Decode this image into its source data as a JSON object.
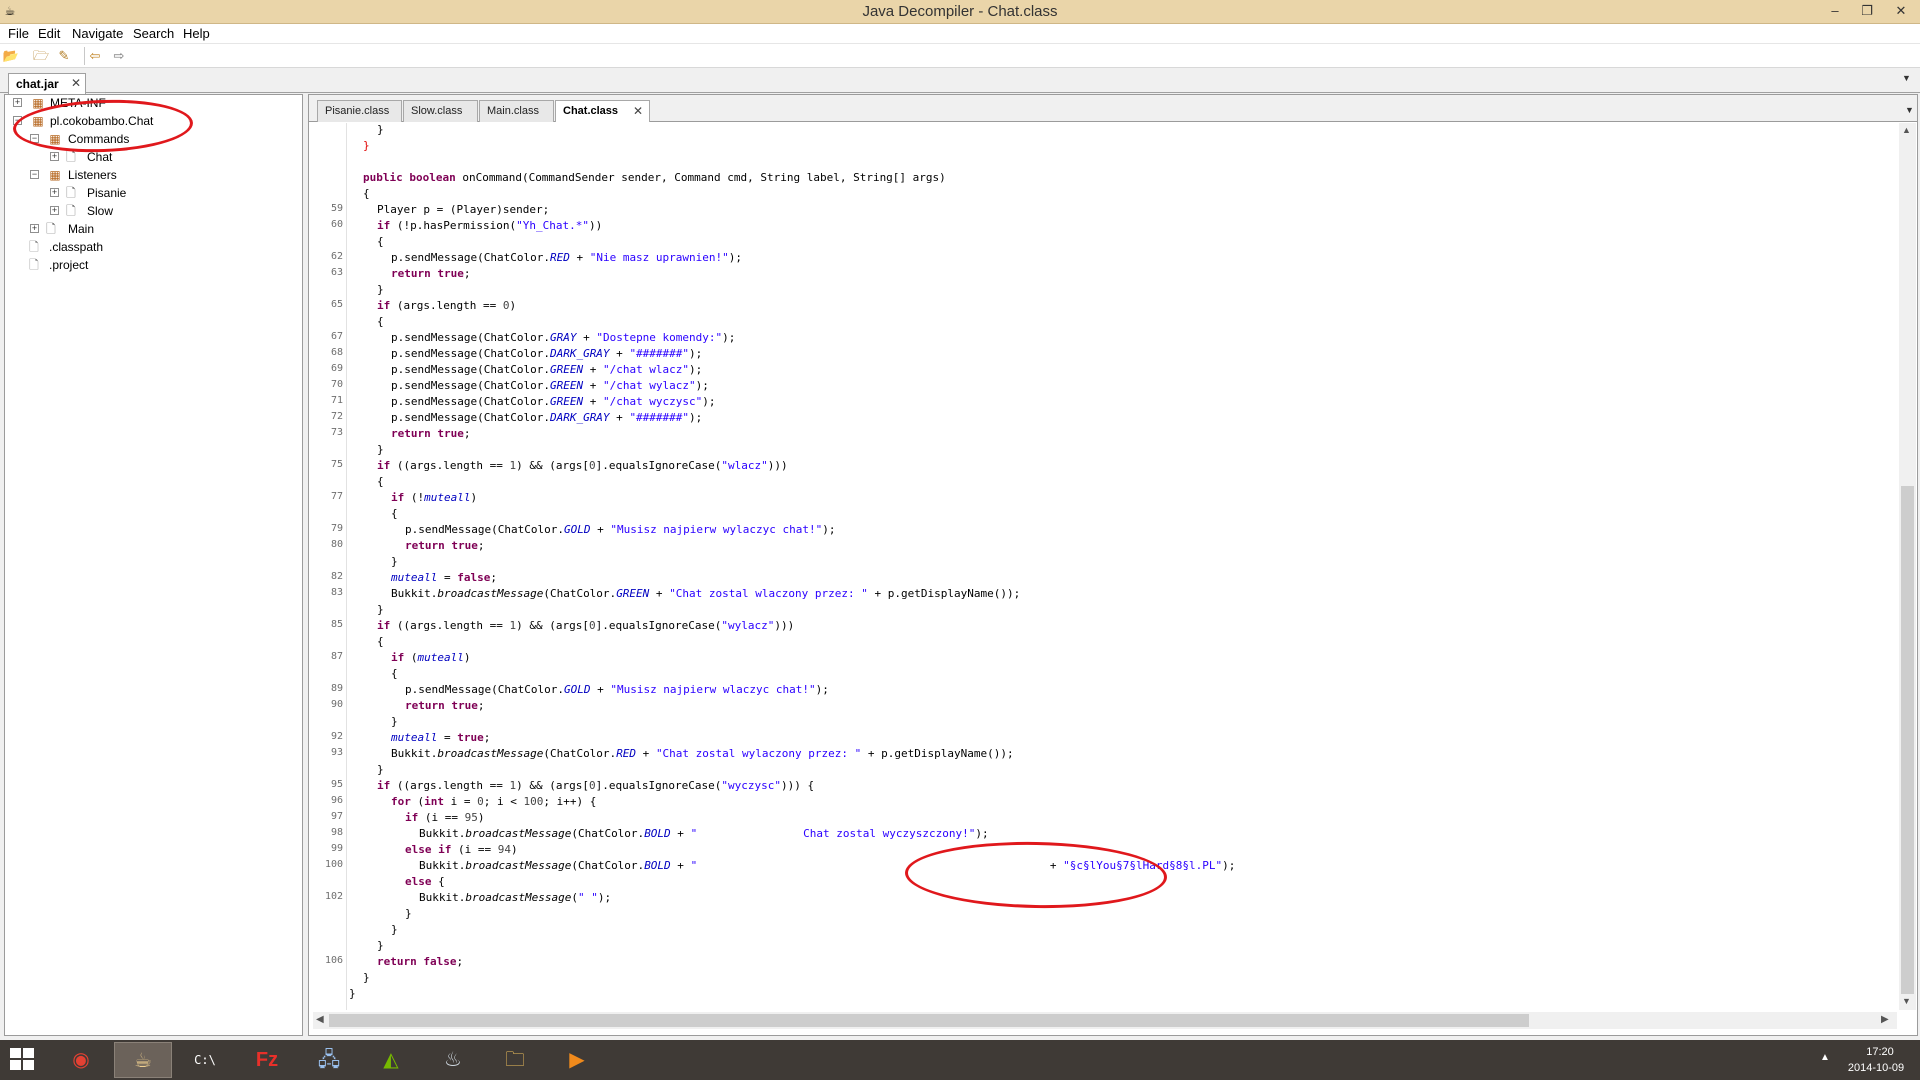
{
  "window": {
    "title": "Java Decompiler - Chat.class",
    "minimize_glyph": "–",
    "maximize_glyph": "❐",
    "close_glyph": "✕"
  },
  "menu": [
    "File",
    "Edit",
    "Navigate",
    "Search",
    "Help"
  ],
  "toolbar": {
    "icons": [
      "open-file-icon",
      "open-type-icon",
      "find-icon",
      "back-icon",
      "forward-icon"
    ],
    "glyphs": [
      "📂",
      "🗁",
      "✎",
      "⇦",
      "⇨"
    ]
  },
  "jar_tab": {
    "label": "chat.jar",
    "close": "✕",
    "dropdown": "▼"
  },
  "tree": {
    "meta_inf": "META-INF",
    "package": "pl.cokobambo.Chat",
    "commands": "Commands",
    "chat": "Chat",
    "listeners": "Listeners",
    "pisanie": "Pisanie",
    "slow": "Slow",
    "main": "Main",
    "classpath": ".classpath",
    "project": ".project",
    "expand_plus": "+",
    "expand_minus": "−"
  },
  "editor_tabs": [
    {
      "label": "Pisanie.class"
    },
    {
      "label": "Slow.class"
    },
    {
      "label": "Main.class"
    },
    {
      "label": "Chat.class",
      "close": "✕"
    }
  ],
  "editor_dropdown": "▼",
  "line_numbers": [
    "59",
    "60",
    "62",
    "63",
    "65",
    "67",
    "68",
    "69",
    "70",
    "71",
    "72",
    "73",
    "75",
    "77",
    "79",
    "80",
    "82",
    "83",
    "85",
    "87",
    "89",
    "90",
    "92",
    "93",
    "95",
    "96",
    "97",
    "98",
    "99",
    "100",
    "102",
    "106"
  ],
  "code": {
    "l1": "}",
    "l2": "}",
    "l3_kw": "public boolean",
    "l3_rest": " onCommand(CommandSender sender, Command cmd, String label, String[] args)",
    "l4": "{",
    "l5": "Player p = (Player)sender;",
    "l6_kw": "if",
    "l6_a": " (!p.hasPermission(",
    "l6_s": "\"Yh_Chat.*\"",
    "l6_b": "))",
    "l7": "{",
    "l8_a": "p.sendMessage(ChatColor.",
    "l8_f": "RED",
    "l8_b": " + ",
    "l8_s": "\"Nie masz uprawnien!\"",
    "l8_c": ");",
    "l9_kw": "return true",
    "l9_b": ";",
    "l10": "}",
    "l11_kw": "if",
    "l11_a": " (args.length == ",
    "l11_n": "0",
    "l11_b": ")",
    "l12": "{",
    "l13_a": "p.sendMessage(ChatColor.",
    "l13_f": "GRAY",
    "l13_b": " + ",
    "l13_s": "\"Dostepne komendy:\"",
    "l13_c": ");",
    "l14_a": "p.sendMessage(ChatColor.",
    "l14_f": "DARK_GRAY",
    "l14_b": " + ",
    "l14_s": "\"#######\"",
    "l14_c": ");",
    "l15_a": "p.sendMessage(ChatColor.",
    "l15_f": "GREEN",
    "l15_b": " + ",
    "l15_s": "\"/chat wlacz\"",
    "l15_c": ");",
    "l16_a": "p.sendMessage(ChatColor.",
    "l16_f": "GREEN",
    "l16_b": " + ",
    "l16_s": "\"/chat wylacz\"",
    "l16_c": ");",
    "l17_a": "p.sendMessage(ChatColor.",
    "l17_f": "GREEN",
    "l17_b": " + ",
    "l17_s": "\"/chat wyczysc\"",
    "l17_c": ");",
    "l18_a": "p.sendMessage(ChatColor.",
    "l18_f": "DARK_GRAY",
    "l18_b": " + ",
    "l18_s": "\"#######\"",
    "l18_c": ");",
    "l19_kw": "return true",
    "l19_b": ";",
    "l20": "}",
    "l21_kw": "if",
    "l21_a": " ((args.length == ",
    "l21_n1": "1",
    "l21_b": ") && (args[",
    "l21_n2": "0",
    "l21_c": "].equalsIgnoreCase(",
    "l21_s": "\"wlacz\"",
    "l21_d": ")))",
    "l22": "{",
    "l23_kw": "if",
    "l23_a": " (!",
    "l23_f": "muteall",
    "l23_b": ")",
    "l24": "{",
    "l25_a": "p.sendMessage(ChatColor.",
    "l25_f": "GOLD",
    "l25_b": " + ",
    "l25_s": "\"Musisz najpierw wylaczyc chat!\"",
    "l25_c": ");",
    "l26_kw": "return true",
    "l26_b": ";",
    "l27": "}",
    "l28_f": "muteall",
    "l28_a": " = ",
    "l28_kw": "false",
    "l28_b": ";",
    "l29_a": "Bukkit.",
    "l29_m": "broadcastMessage",
    "l29_b": "(ChatColor.",
    "l29_f": "GREEN",
    "l29_c": " + ",
    "l29_s": "\"Chat zostal wlaczony przez: \"",
    "l29_d": " + p.getDisplayName());",
    "l30": "}",
    "l31_kw": "if",
    "l31_a": " ((args.length == ",
    "l31_n1": "1",
    "l31_b": ") && (args[",
    "l31_n2": "0",
    "l31_c": "].equalsIgnoreCase(",
    "l31_s": "\"wylacz\"",
    "l31_d": ")))",
    "l32": "{",
    "l33_kw": "if",
    "l33_a": " (",
    "l33_f": "muteall",
    "l33_b": ")",
    "l34": "{",
    "l35_a": "p.sendMessage(ChatColor.",
    "l35_f": "GOLD",
    "l35_b": " + ",
    "l35_s": "\"Musisz najpierw wlaczyc chat!\"",
    "l35_c": ");",
    "l36_kw": "return true",
    "l36_b": ";",
    "l37": "}",
    "l38_f": "muteall",
    "l38_a": " = ",
    "l38_kw": "true",
    "l38_b": ";",
    "l39_a": "Bukkit.",
    "l39_m": "broadcastMessage",
    "l39_b": "(ChatColor.",
    "l39_f": "RED",
    "l39_c": " + ",
    "l39_s": "\"Chat zostal wylaczony przez: \"",
    "l39_d": " + p.getDisplayName());",
    "l40": "}",
    "l41_kw": "if",
    "l41_a": " ((args.length == ",
    "l41_n1": "1",
    "l41_b": ") && (args[",
    "l41_n2": "0",
    "l41_c": "].equalsIgnoreCase(",
    "l41_s": "\"wyczysc\"",
    "l41_d": "))) {",
    "l42_kw1": "for",
    "l42_a": " (",
    "l42_kw2": "int",
    "l42_b": " i = ",
    "l42_n1": "0",
    "l42_c": "; i < ",
    "l42_n2": "100",
    "l42_d": "; i++) {",
    "l43_kw": "if",
    "l43_a": " (i == ",
    "l43_n": "95",
    "l43_b": ")",
    "l44_a": "Bukkit.",
    "l44_m": "broadcastMessage",
    "l44_b": "(ChatColor.",
    "l44_f": "BOLD",
    "l44_c": " + ",
    "l44_s": "\"                Chat zostal wyczyszczony!\"",
    "l44_d": ");",
    "l45_kw": "else if",
    "l45_a": " (i == ",
    "l45_n": "94",
    "l45_b": ")",
    "l46_a": "Bukkit.",
    "l46_m": "broadcastMessage",
    "l46_b": "(ChatColor.",
    "l46_f": "BOLD",
    "l46_c": " + ",
    "l46_s1": "\"                              ",
    "l46_d": "+ ",
    "l46_s2": "\"§c§lYou§7§lHard§8§l.PL\"",
    "l46_e": ");",
    "l47_kw": "else",
    "l47_a": " {",
    "l48_a": "Bukkit.",
    "l48_m": "broadcastMessage",
    "l48_b": "(",
    "l48_s": "\" \"",
    "l48_c": ");",
    "l49": "}",
    "l50": "}",
    "l51": "}",
    "l52_kw": "return false",
    "l52_b": ";",
    "l53": "}",
    "l54": "}"
  },
  "scroll": {
    "up": "▲",
    "down": "▼",
    "left": "◀",
    "right": "▶"
  },
  "taskbar": {
    "apps": [
      "chrome-icon",
      "java-decompiler-icon",
      "cmd-icon",
      "filezilla-icon",
      "network-icon",
      "nvidia-icon",
      "steam-icon",
      "explorer-icon",
      "media-player-icon"
    ],
    "glyphs": [
      "◉",
      "☕",
      "C:\\",
      "Fz",
      "🖧",
      "◭",
      "♨",
      "🗀",
      "▶"
    ],
    "tray_arrow": "▲",
    "time": "17:20",
    "date": "2014-10-09"
  },
  "colors": {
    "keyword": "#7f0055",
    "string": "#2a00ff",
    "field": "#0000c0",
    "annotation": "#e0181c",
    "titlebar": "#ead5a9",
    "taskbar": "#3f3a36"
  }
}
